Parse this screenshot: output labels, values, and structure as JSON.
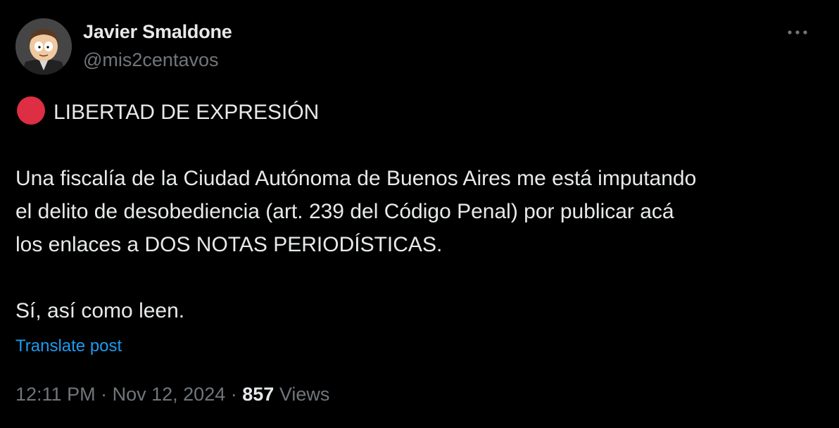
{
  "colors": {
    "background": "#000000",
    "text_primary": "#e7e9ea",
    "text_secondary": "#71767b",
    "link": "#1d9bf0",
    "red_circle": "#dd2e44"
  },
  "author": {
    "name": "Javier Smaldone",
    "handle": "@mis2centavos",
    "avatar_icon": "cartoon-avatar-icon"
  },
  "post": {
    "line1": "LIBERTAD DE EXPRESIÓN",
    "line1_emoji": "red-circle-icon",
    "paragraph2": [
      "Una fiscalía de la Ciudad Autónoma de Buenos Aires me está imputando",
      "el delito de desobediencia (art. 239 del Código Penal) por publicar acá",
      "los enlaces a DOS NOTAS PERIODÍSTICAS."
    ],
    "paragraph3": "Sí, así como leen."
  },
  "translate": {
    "label": "Translate post"
  },
  "meta": {
    "time": "12:11 PM",
    "separator": "·",
    "date": "Nov 12, 2024",
    "views_count": "857",
    "views_label": "Views"
  },
  "menu": {
    "icon": "more-options-icon"
  }
}
